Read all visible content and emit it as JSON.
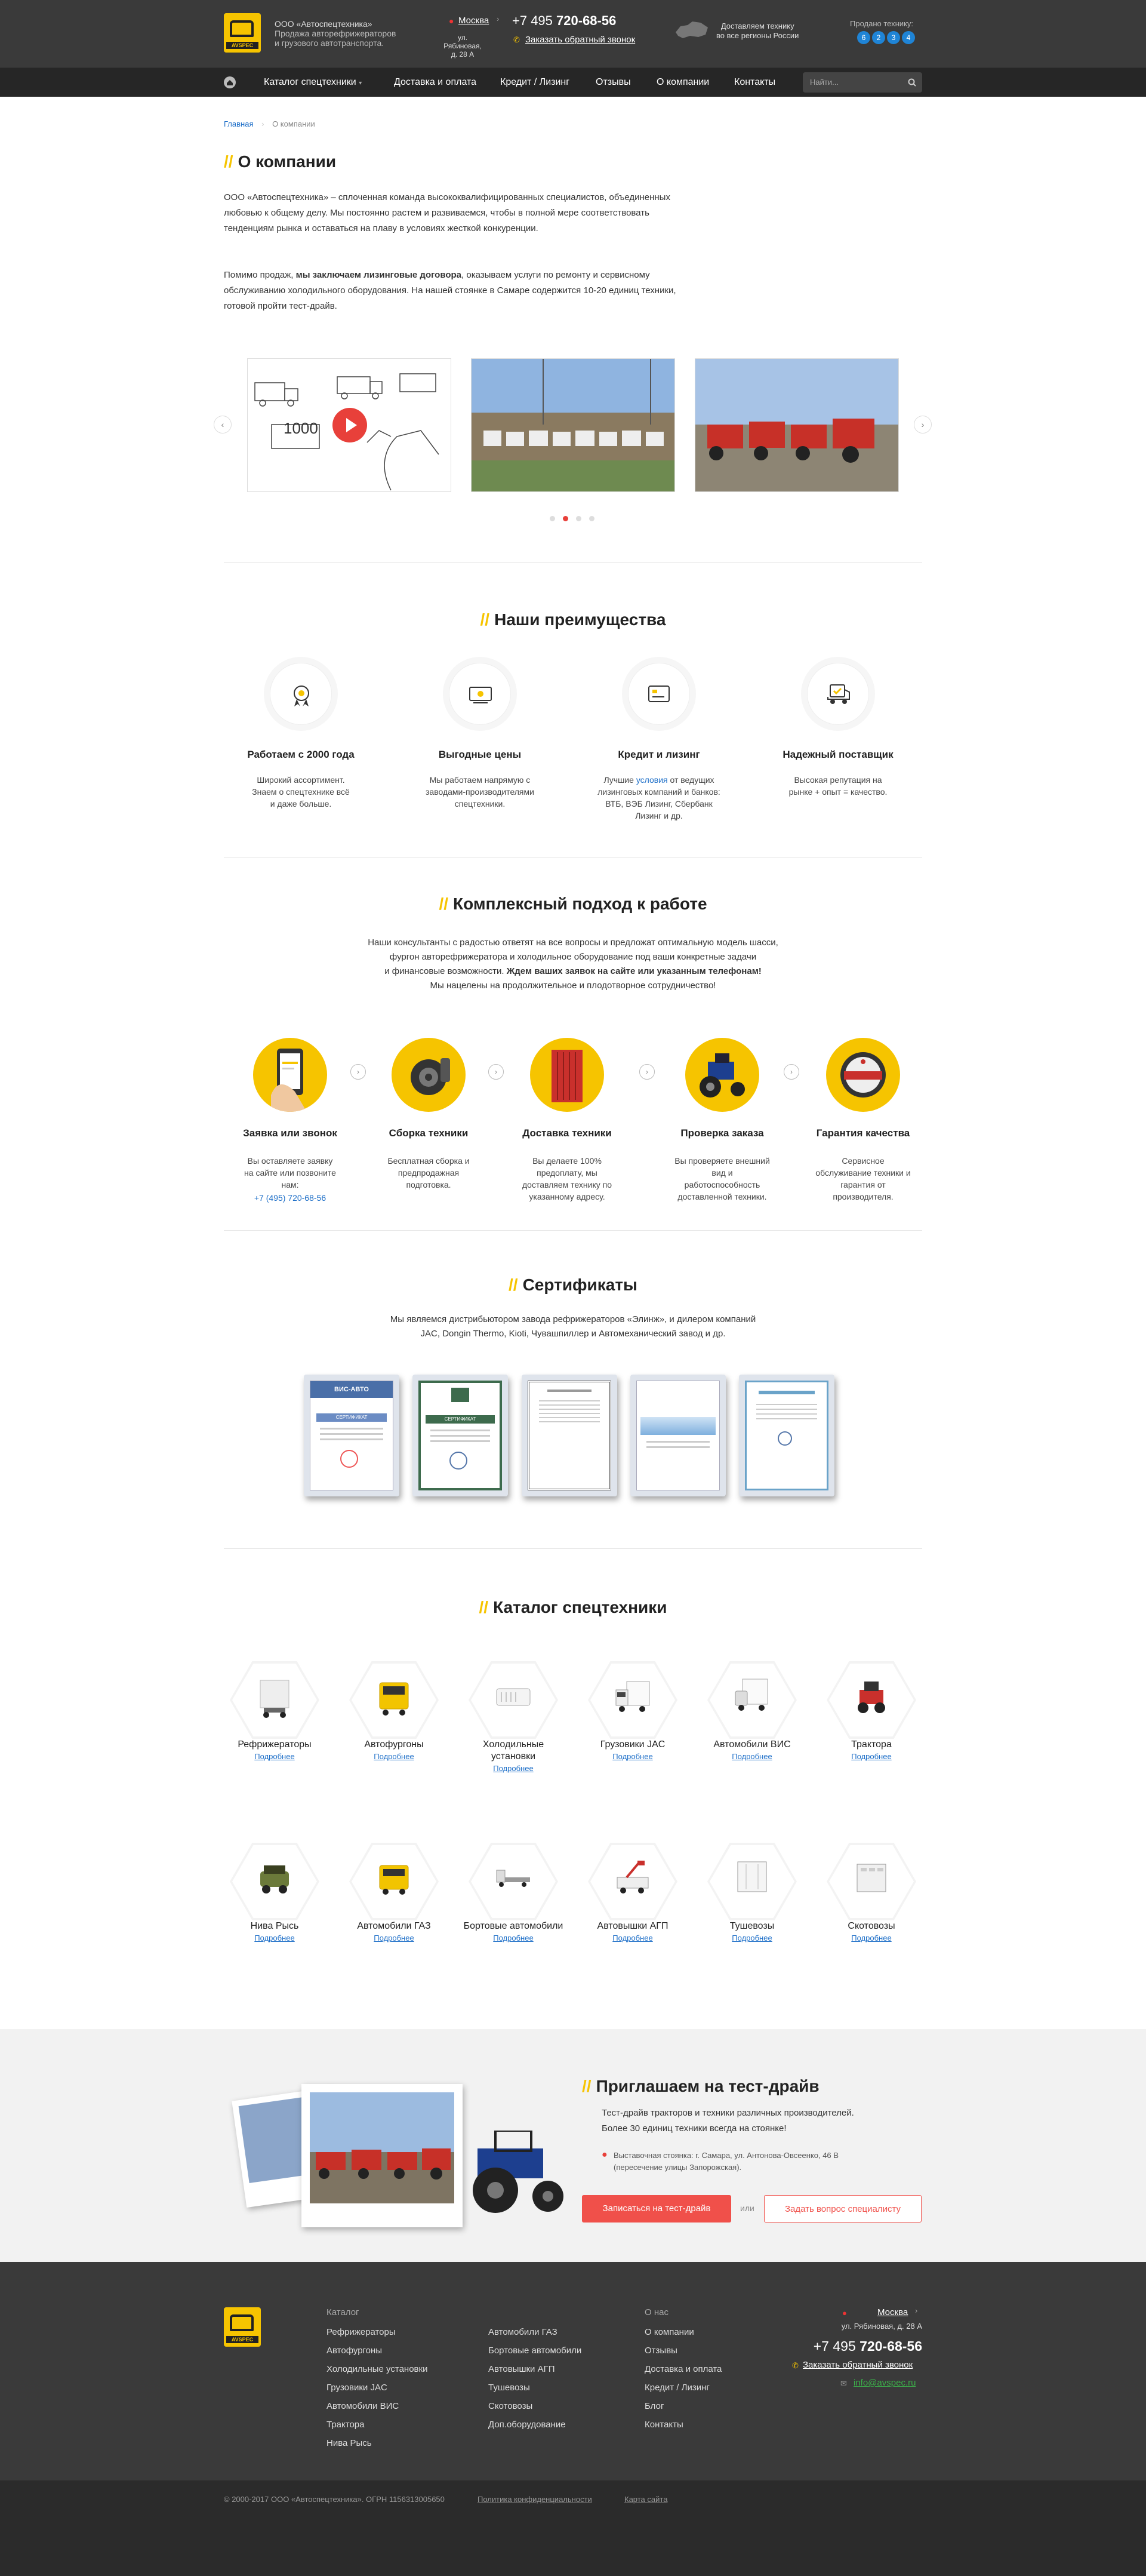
{
  "header": {
    "company": "ООО «Автоспецтехника»",
    "tagline_1": "Продажа авторефрижераторов",
    "tagline_2": "и грузового автотранспорта.",
    "city": "Москва",
    "address_1": "ул. Рябиновая,",
    "address_2": "д. 28 А",
    "phone_code": "+7 495",
    "phone_number": "720-68-56",
    "callback": "Заказать обратный звонок",
    "delivery_1": "Доставляем технику",
    "delivery_2": "во все регионы России",
    "sold_label": "Продано технику:",
    "sold_digits": [
      "6",
      "2",
      "3",
      "4"
    ]
  },
  "nav": {
    "items": [
      "Каталог спецтехники",
      "Доставка и оплата",
      "Кредит / Лизинг",
      "Отзывы",
      "О компании",
      "Контакты"
    ],
    "search_placeholder": "Найти..."
  },
  "breadcrumb": {
    "home": "Главная",
    "current": "О компании"
  },
  "about": {
    "title": "О компании",
    "p1": "ООО «Автоспецтехника» – сплоченная команда высококвалифицированных специалистов, объединенных любовью к общему делу. Мы постоянно растем и развиваемся, чтобы в полной мере соответствовать тенденциям рынка и оставаться на плаву в условиях жесткой конкуренции.",
    "p2_a": "Помимо продаж, ",
    "p2_b": "мы заключаем лизинговые договора",
    "p2_c": ", оказываем услуги по ремонту и сервисному обслуживанию холодильного оборудования. На нашей стоянке в Самаре содержится 10-20 единиц техники, готовой пройти тест-драйв."
  },
  "advantages": {
    "title": "Наши преимущества",
    "items": [
      {
        "title": "Работаем с 2000 года",
        "text": "Широкий ассортимент. Знаем о спецтехнике всё и даже больше.",
        "icon": "medal-icon"
      },
      {
        "title": "Выгодные цены",
        "text": "Мы работаем напрямую с заводами-производителями спецтехники.",
        "icon": "money-icon"
      },
      {
        "title": "Кредит и лизинг",
        "text_a": "Лучшие ",
        "link": "условия",
        "text_b": " от ведущих лизинговых компаний и банков: ВТБ, ВЭБ Лизинг, Сбербанк Лизинг и др.",
        "icon": "card-icon"
      },
      {
        "title": "Надежный поставщик",
        "text": "Высокая репутация на рынке + опыт = качество.",
        "icon": "truck-icon"
      }
    ]
  },
  "approach": {
    "title": "Комплексный подход к работе",
    "l1": "Наши консультанты с радостью ответят на все вопросы и предложат оптимальную модель шасси,",
    "l2": "фургон авторефрижератора и холодильное оборудование под ваши конкретные задачи",
    "l3a": "и финансовые возможности. ",
    "l3b": "Ждем ваших заявок на сайте или указанным телефонам!",
    "l4": "Мы нацелены на продолжительное и плодотворное сотрудничество!",
    "steps": [
      {
        "title": "Заявка или звонок",
        "text": "Вы оставляете заявку на сайте или позвоните нам:",
        "link": "+7 (495) 720-68-56"
      },
      {
        "title": "Сборка техники",
        "text": "Бесплатная сборка и предпродажная подготовка."
      },
      {
        "title": "Доставка техники",
        "text": "Вы делаете 100% предоплату, мы доставляем технику по указанному адресу."
      },
      {
        "title": "Проверка заказа",
        "text": "Вы проверяете внешний вид и работоспособность доставленной техники."
      },
      {
        "title": "Гарантия качества",
        "text": "Сервисное обслуживание техники и гарантия от производителя."
      }
    ]
  },
  "certificates": {
    "title": "Сертификаты",
    "l1": "Мы являемся дистрибьютором завода рефрижераторов «Элинж», и дилером компаний",
    "l2": "JAC, Dongin Thermo, Kioti, Чувашпиллер и Автомеханический завод и др.",
    "cert_labels": [
      "ВИС-АВТО",
      "СЕРТИФИКАТ",
      "СЕРТИФИКАТ"
    ]
  },
  "catalog": {
    "title": "Каталог спецтехники",
    "more": "Подробнее",
    "row1": [
      {
        "name": "Рефрижераторы"
      },
      {
        "name": "Автофургоны"
      },
      {
        "name": "Холодильные установки"
      },
      {
        "name": "Грузовики JAC"
      },
      {
        "name": "Автомобили ВИС"
      },
      {
        "name": "Трактора"
      }
    ],
    "row2": [
      {
        "name": "Нива Рысь"
      },
      {
        "name": "Автомобили ГАЗ"
      },
      {
        "name": "Бортовые автомобили"
      },
      {
        "name": "Автовышки АГП"
      },
      {
        "name": "Тушевозы"
      },
      {
        "name": "Скотовозы"
      }
    ]
  },
  "testdrive": {
    "title": "Приглашаем на тест-драйв",
    "l1": "Тест-драйв тракторов и техники различных производителей.",
    "l2": "Более 30 единиц техники всегда на стоянке!",
    "addr1": "Выставочная стоянка: г. Самара, ул. Антонова-Овсеенко, 46 В",
    "addr2": "(пересечение улицы Запорожская).",
    "btn_signup": "Записаться на тест-драйв",
    "or": "или",
    "btn_ask": "Задать вопрос специалисту"
  },
  "footer": {
    "catalog_head": "Каталог",
    "catalog_col1": [
      "Рефрижераторы",
      "Автофургоны",
      "Холодильные установки",
      "Грузовики JAC",
      "Автомобили ВИС",
      "Трактора",
      "Нива Рысь"
    ],
    "catalog_col2": [
      "Автомобили ГАЗ",
      "Бортовые автомобили",
      "Автовышки АГП",
      "Тушевозы",
      "Скотовозы",
      "Доп.оборудование"
    ],
    "about_head": "О нас",
    "about_links": [
      "О компании",
      "Отзывы",
      "Доставка и оплата",
      "Кредит / Лизинг",
      "Блог",
      "Контакты"
    ],
    "city": "Москва",
    "address": "ул. Рябиновая, д. 28 А",
    "phone_code": "+7 495",
    "phone_number": "720-68-56",
    "callback": "Заказать обратный звонок",
    "email": "info@avspec.ru",
    "copyright": "© 2000-2017 ООО «Автоспецтехника». ОГРН 1156313005650",
    "privacy": "Политика конфиденциальности",
    "sitemap": "Карта сайта"
  }
}
